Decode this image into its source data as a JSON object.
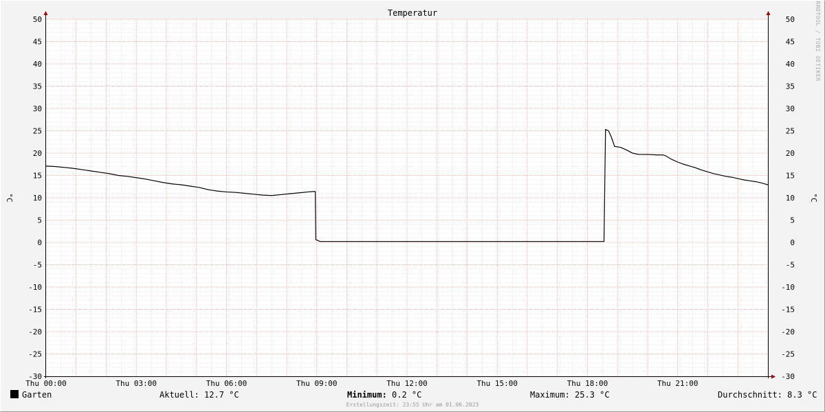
{
  "chart_data": {
    "type": "line",
    "title": "Temperatur",
    "ylabel_left": "°C",
    "ylabel_right": "°C",
    "ylim": [
      -30,
      50
    ],
    "y_ticks": [
      "50",
      "45",
      "40",
      "35",
      "30",
      "25",
      "20",
      "15",
      "10",
      "5",
      "0",
      "-5",
      "-10",
      "-15",
      "-20",
      "-25",
      "-30"
    ],
    "xlim": [
      0,
      24
    ],
    "x_tick_labels": [
      {
        "hour": 0,
        "label": "Thu 00:00"
      },
      {
        "hour": 3,
        "label": "Thu 03:00"
      },
      {
        "hour": 6,
        "label": "Thu 06:00"
      },
      {
        "hour": 9,
        "label": "Thu 09:00"
      },
      {
        "hour": 12,
        "label": "Thu 12:00"
      },
      {
        "hour": 15,
        "label": "Thu 15:00"
      },
      {
        "hour": 18,
        "label": "Thu 18:00"
      },
      {
        "hour": 21,
        "label": "Thu 21:00"
      }
    ],
    "grid": true,
    "series": [
      {
        "name": "Garten",
        "color": "#000000",
        "points": [
          [
            0.0,
            17.1
          ],
          [
            0.3,
            17.0
          ],
          [
            0.6,
            16.8
          ],
          [
            0.9,
            16.6
          ],
          [
            1.2,
            16.3
          ],
          [
            1.5,
            16.0
          ],
          [
            1.8,
            15.7
          ],
          [
            2.1,
            15.4
          ],
          [
            2.4,
            15.0
          ],
          [
            2.7,
            14.8
          ],
          [
            3.0,
            14.5
          ],
          [
            3.3,
            14.2
          ],
          [
            3.6,
            13.8
          ],
          [
            3.9,
            13.4
          ],
          [
            4.2,
            13.1
          ],
          [
            4.5,
            12.9
          ],
          [
            4.8,
            12.6
          ],
          [
            5.1,
            12.3
          ],
          [
            5.4,
            11.8
          ],
          [
            5.7,
            11.5
          ],
          [
            6.0,
            11.3
          ],
          [
            6.3,
            11.2
          ],
          [
            6.6,
            11.0
          ],
          [
            6.9,
            10.8
          ],
          [
            7.2,
            10.6
          ],
          [
            7.5,
            10.5
          ],
          [
            7.8,
            10.7
          ],
          [
            8.1,
            10.9
          ],
          [
            8.4,
            11.1
          ],
          [
            8.7,
            11.3
          ],
          [
            8.9,
            11.4
          ],
          [
            8.95,
            11.4
          ],
          [
            8.97,
            0.6
          ],
          [
            9.05,
            0.4
          ],
          [
            9.1,
            0.2
          ],
          [
            12.0,
            0.2
          ],
          [
            15.0,
            0.2
          ],
          [
            18.0,
            0.2
          ],
          [
            18.55,
            0.2
          ],
          [
            18.6,
            25.3
          ],
          [
            18.7,
            25.0
          ],
          [
            18.8,
            23.5
          ],
          [
            18.9,
            21.5
          ],
          [
            19.1,
            21.3
          ],
          [
            19.3,
            20.7
          ],
          [
            19.5,
            20.0
          ],
          [
            19.7,
            19.7
          ],
          [
            20.0,
            19.7
          ],
          [
            20.3,
            19.6
          ],
          [
            20.5,
            19.6
          ],
          [
            20.6,
            19.4
          ],
          [
            20.8,
            18.6
          ],
          [
            21.0,
            18.0
          ],
          [
            21.2,
            17.5
          ],
          [
            21.4,
            17.1
          ],
          [
            21.6,
            16.7
          ],
          [
            21.8,
            16.2
          ],
          [
            22.0,
            15.8
          ],
          [
            22.2,
            15.4
          ],
          [
            22.4,
            15.1
          ],
          [
            22.6,
            14.8
          ],
          [
            22.8,
            14.6
          ],
          [
            23.0,
            14.3
          ],
          [
            23.2,
            14.0
          ],
          [
            23.4,
            13.8
          ],
          [
            23.6,
            13.6
          ],
          [
            23.8,
            13.3
          ],
          [
            24.0,
            12.9
          ]
        ]
      }
    ]
  },
  "watermark": "RRDTOOL / TOBI OETIKER",
  "legend": {
    "series_name": "Garten",
    "aktuell": "Aktuell: 12.7 °C",
    "minimum_label": "Minimum:",
    "minimum_value": "0.2 °C",
    "maximum": "Maximum: 25.3 °C",
    "durchschnitt": "Durchschnitt: 8.3 °C"
  },
  "footer": "Erstellungszeit: 23:55 Uhr am 01.06.2023",
  "colors": {
    "background": "#f3f3f3",
    "canvas": "#ffffff",
    "major_grid": "#f0a0a0",
    "minor_grid": "#d8d8d8",
    "axis_arrow": "#990000"
  }
}
